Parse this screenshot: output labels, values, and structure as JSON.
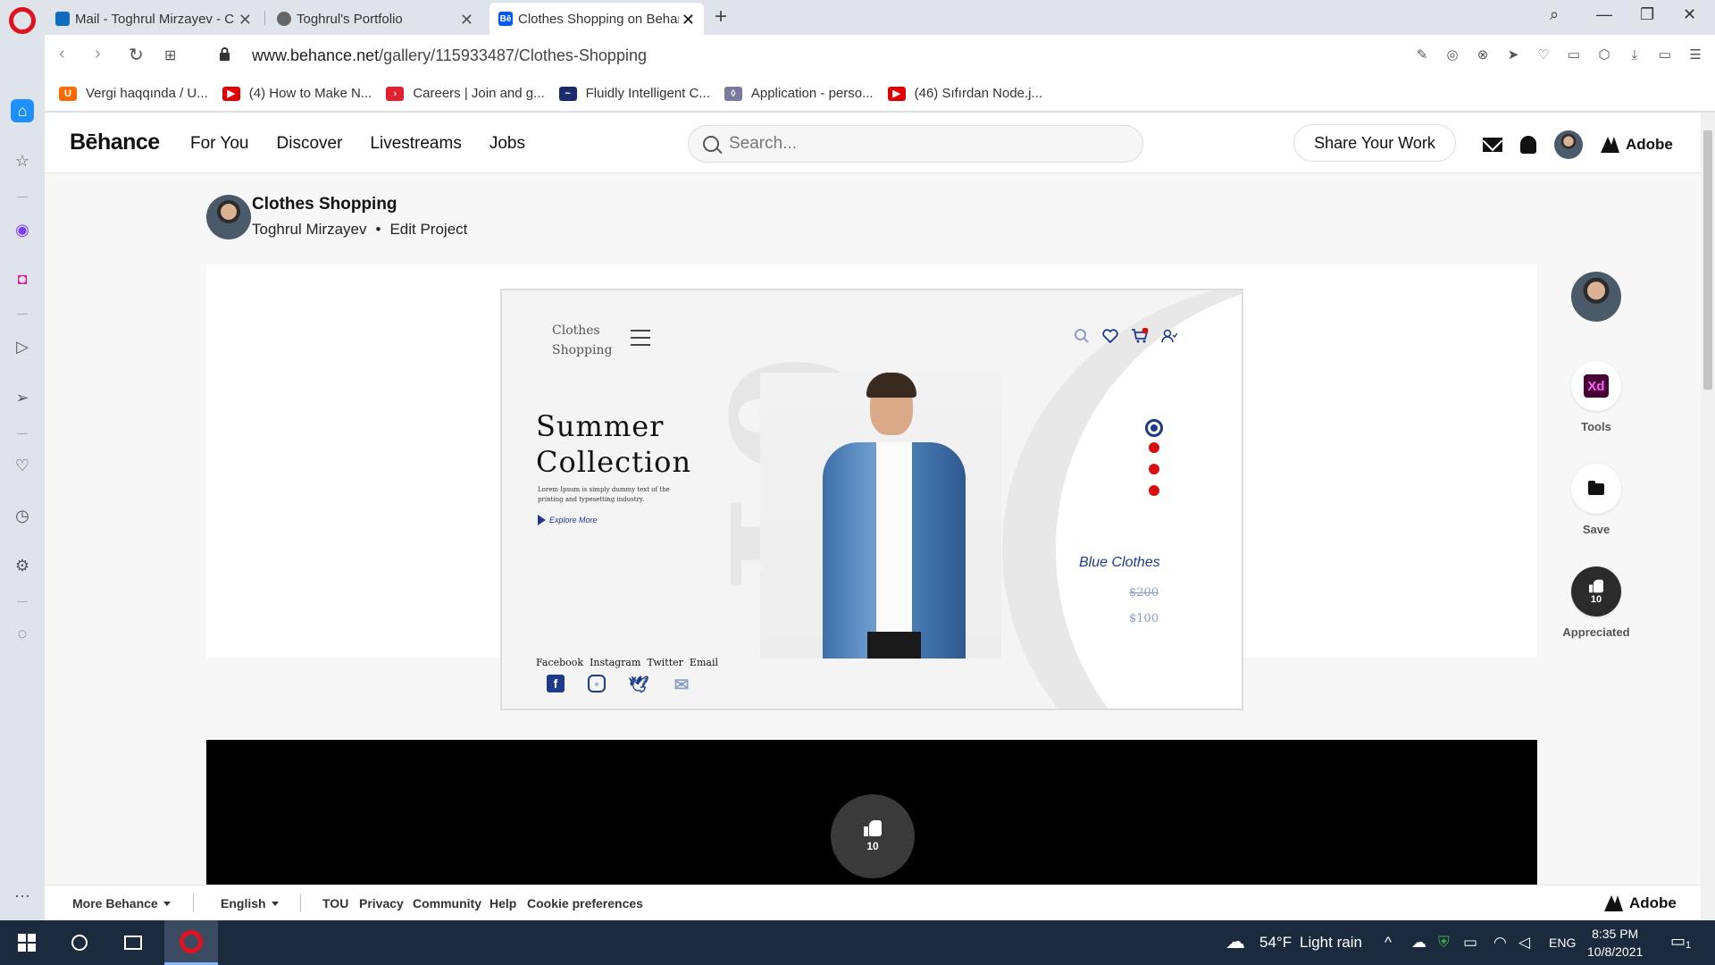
{
  "browser": {
    "tabs": [
      {
        "title": "Mail - Toghrul Mirzayev - C",
        "favicon_color": "#0f6cbd",
        "active": false
      },
      {
        "title": "Toghrul's Portfolio",
        "favicon_color": "#666666",
        "active": false
      },
      {
        "title": "Clothes Shopping on Behan",
        "favicon_color": "#0057ff",
        "active": true
      }
    ],
    "url_domain": "www.behance.net",
    "url_path": "/gallery/115933487/Clothes-Shopping",
    "bookmarks": [
      {
        "label": "Vergi haqqında / U...",
        "icon_color": "#ff6a00",
        "icon_char": "U"
      },
      {
        "label": "(4) How to Make N...",
        "icon_color": "#e00000",
        "icon_char": "▶"
      },
      {
        "label": "Careers | Join and g...",
        "icon_color": "#e4202e",
        "icon_char": "›"
      },
      {
        "label": "Fluidly Intelligent C...",
        "icon_color": "#1b2a6b",
        "icon_char": "~"
      },
      {
        "label": "Application - perso...",
        "icon_color": "#7a7aa0",
        "icon_char": "◊"
      },
      {
        "label": "(46) Sıfırdan Node.j...",
        "icon_color": "#e00000",
        "icon_char": "▶"
      }
    ]
  },
  "behance": {
    "logo": "Bēhance",
    "nav": [
      "For You",
      "Discover",
      "Livestreams",
      "Jobs"
    ],
    "search_placeholder": "Search...",
    "share_label": "Share Your Work",
    "adobe_label": "Adobe"
  },
  "project": {
    "title": "Clothes Shopping",
    "author": "Toghrul Mirzayev",
    "separator": "•",
    "edit_label": "Edit Project"
  },
  "mockup": {
    "logo_line1": "Clothes",
    "logo_line2": "Shopping",
    "headline_line1": "Summer",
    "headline_line2": "Collection",
    "lorem": "Lorem Ipsum is simply dummy text of the printing and typesetting industry.",
    "explore": "Explore More",
    "product_name": "Blue Clothes",
    "old_price": "$200",
    "new_price": "$100",
    "social_labels": [
      "Facebook",
      "Instagram",
      "Twitter",
      "Email"
    ],
    "accent": "#1e3a8a",
    "dot_color": "#d90f0f"
  },
  "rail": {
    "tools_label": "Tools",
    "tools_badge": "Xd",
    "save_label": "Save",
    "appreciated_label": "Appreciated",
    "appreciations": "10"
  },
  "like_count": "10",
  "footer": {
    "more": "More Behance",
    "language": "English",
    "links": [
      "TOU",
      "Privacy",
      "Community",
      "Help",
      "Cookie preferences"
    ],
    "adobe": "Adobe"
  },
  "taskbar": {
    "weather_temp": "54°F",
    "weather_text": "Light rain",
    "lang": "ENG",
    "time": "8:35 PM",
    "date": "10/8/2021",
    "notifications": "1"
  }
}
